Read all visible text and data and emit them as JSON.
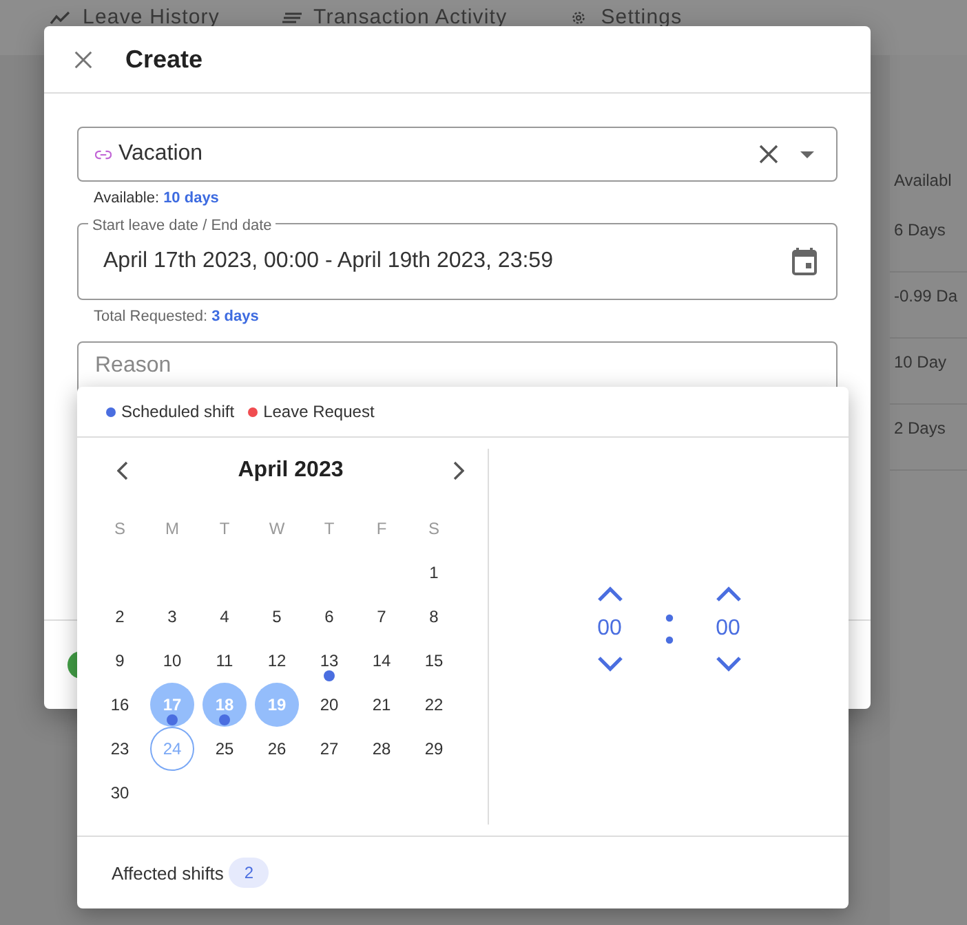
{
  "nav_tabs": [
    {
      "label": "Leave History",
      "kind": "trend"
    },
    {
      "label": "Transaction Activity",
      "kind": "lines"
    },
    {
      "label": "Settings",
      "kind": "gear"
    }
  ],
  "balance_table": {
    "header": "Availabl",
    "rows": [
      "6 Days",
      "-0.99 Da",
      "10 Day",
      "2 Days"
    ]
  },
  "dialog": {
    "title": "Create",
    "leave_type": {
      "value": "Vacation"
    },
    "available": {
      "label": "Available:",
      "value": "10 days"
    },
    "date_range": {
      "label": "Start leave date / End date",
      "value": "April 17th 2023, 00:00 - April 19th 2023, 23:59"
    },
    "total_requested": {
      "label": "Total Requested:",
      "value": "3 days"
    },
    "reason": {
      "placeholder": "Reason"
    }
  },
  "date_picker": {
    "legend": [
      {
        "label": "Scheduled shift",
        "color": "#4a6ee0"
      },
      {
        "label": "Leave Request",
        "color": "#f04c50"
      }
    ],
    "month": "April 2023",
    "weekdays": [
      "S",
      "M",
      "T",
      "W",
      "T",
      "F",
      "S"
    ],
    "weeks": [
      {
        "days": [
          {
            "label": "1",
            "in_range": false,
            "today": false,
            "scheduled_shift": false
          }
        ]
      },
      {
        "days": [
          {
            "label": "2",
            "in_range": false,
            "today": false,
            "scheduled_shift": false
          },
          {
            "label": "3",
            "in_range": false,
            "today": false,
            "scheduled_shift": false
          },
          {
            "label": "4",
            "in_range": false,
            "today": false,
            "scheduled_shift": false
          },
          {
            "label": "5",
            "in_range": false,
            "today": false,
            "scheduled_shift": false
          },
          {
            "label": "6",
            "in_range": false,
            "today": false,
            "scheduled_shift": false
          },
          {
            "label": "7",
            "in_range": false,
            "today": false,
            "scheduled_shift": false
          },
          {
            "label": "8",
            "in_range": false,
            "today": false,
            "scheduled_shift": false
          }
        ]
      },
      {
        "days": [
          {
            "label": "9",
            "in_range": false,
            "today": false,
            "scheduled_shift": false
          },
          {
            "label": "10",
            "in_range": false,
            "today": false,
            "scheduled_shift": false
          },
          {
            "label": "11",
            "in_range": false,
            "today": false,
            "scheduled_shift": false
          },
          {
            "label": "12",
            "in_range": false,
            "today": false,
            "scheduled_shift": false
          },
          {
            "label": "13",
            "in_range": false,
            "today": false,
            "scheduled_shift": true
          },
          {
            "label": "14",
            "in_range": false,
            "today": false,
            "scheduled_shift": false
          },
          {
            "label": "15",
            "in_range": false,
            "today": false,
            "scheduled_shift": false
          }
        ]
      },
      {
        "days": [
          {
            "label": "16",
            "in_range": false,
            "today": false,
            "scheduled_shift": false
          },
          {
            "label": "17",
            "in_range": true,
            "today": false,
            "scheduled_shift": true
          },
          {
            "label": "18",
            "in_range": true,
            "today": false,
            "scheduled_shift": true
          },
          {
            "label": "19",
            "in_range": true,
            "today": false,
            "scheduled_shift": false
          },
          {
            "label": "20",
            "in_range": false,
            "today": false,
            "scheduled_shift": false
          },
          {
            "label": "21",
            "in_range": false,
            "today": false,
            "scheduled_shift": false
          },
          {
            "label": "22",
            "in_range": false,
            "today": false,
            "scheduled_shift": false
          }
        ]
      },
      {
        "days": [
          {
            "label": "23",
            "in_range": false,
            "today": false,
            "scheduled_shift": false
          },
          {
            "label": "24",
            "in_range": false,
            "today": true,
            "scheduled_shift": false
          },
          {
            "label": "25",
            "in_range": false,
            "today": false,
            "scheduled_shift": false
          },
          {
            "label": "26",
            "in_range": false,
            "today": false,
            "scheduled_shift": false
          },
          {
            "label": "27",
            "in_range": false,
            "today": false,
            "scheduled_shift": false
          },
          {
            "label": "28",
            "in_range": false,
            "today": false,
            "scheduled_shift": false
          },
          {
            "label": "29",
            "in_range": false,
            "today": false,
            "scheduled_shift": false
          }
        ]
      },
      {
        "days": [
          {
            "label": "30",
            "in_range": false,
            "today": false,
            "scheduled_shift": false
          }
        ]
      }
    ],
    "time": {
      "hours": "00",
      "minutes": "00"
    },
    "affected_shifts": {
      "label": "Affected shifts",
      "count": "2"
    }
  }
}
